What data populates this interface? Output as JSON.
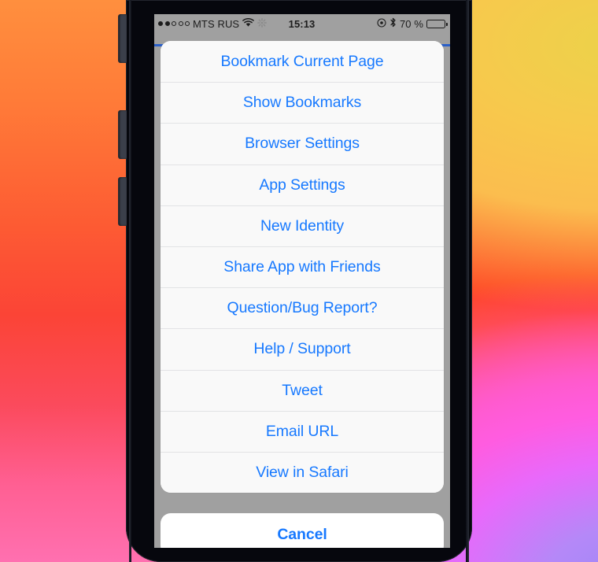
{
  "status_bar": {
    "signal_dots_total": 5,
    "signal_dots_filled": 2,
    "carrier": "MTS RUS",
    "wifi_icon": "wifi-icon",
    "sync_icon": "sync-spinner-icon",
    "clock": "15:13",
    "alarm_icon": "location-alarm-icon",
    "bluetooth_icon": "bluetooth-icon",
    "battery_percent": "70 %",
    "battery_level": 70
  },
  "action_sheet": {
    "items": [
      {
        "label": "Bookmark Current Page",
        "name": "sheet-item-bookmark-current-page"
      },
      {
        "label": "Show Bookmarks",
        "name": "sheet-item-show-bookmarks"
      },
      {
        "label": "Browser Settings",
        "name": "sheet-item-browser-settings"
      },
      {
        "label": "App Settings",
        "name": "sheet-item-app-settings"
      },
      {
        "label": "New Identity",
        "name": "sheet-item-new-identity"
      },
      {
        "label": "Share App with Friends",
        "name": "sheet-item-share-app-with-friends"
      },
      {
        "label": "Question/Bug Report?",
        "name": "sheet-item-question-bug-report"
      },
      {
        "label": "Help / Support",
        "name": "sheet-item-help-support"
      },
      {
        "label": "Tweet",
        "name": "sheet-item-tweet"
      },
      {
        "label": "Email URL",
        "name": "sheet-item-email-url"
      },
      {
        "label": "View in Safari",
        "name": "sheet-item-view-in-safari"
      }
    ],
    "cancel_label": "Cancel"
  },
  "colors": {
    "accent_blue": "#1779ff",
    "sheet_background": "#f9f9f9",
    "separator": "#e2e3e5",
    "cancel_background": "#ffffff",
    "screen_dim": "#a0a0a0",
    "progress_bar": "#2a5fc8"
  }
}
